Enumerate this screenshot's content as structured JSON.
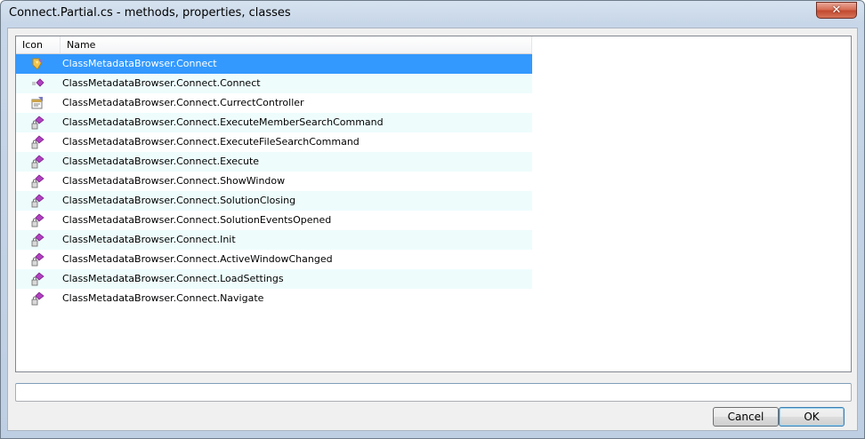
{
  "window": {
    "title": "Connect.Partial.cs - methods, properties, classes",
    "close_glyph": "✕"
  },
  "list": {
    "columns": {
      "icon": "Icon",
      "name": "Name"
    },
    "items": [
      {
        "icon": "class-icon",
        "name": "ClassMetadataBrowser.Connect",
        "selected": true
      },
      {
        "icon": "constructor-icon",
        "name": "ClassMetadataBrowser.Connect.Connect"
      },
      {
        "icon": "property-icon",
        "name": "ClassMetadataBrowser.Connect.CurrectController"
      },
      {
        "icon": "private-method-icon",
        "name": "ClassMetadataBrowser.Connect.ExecuteMemberSearchCommand"
      },
      {
        "icon": "private-method-icon",
        "name": "ClassMetadataBrowser.Connect.ExecuteFileSearchCommand"
      },
      {
        "icon": "private-method-icon",
        "name": "ClassMetadataBrowser.Connect.Execute"
      },
      {
        "icon": "private-method-icon",
        "name": "ClassMetadataBrowser.Connect.ShowWindow"
      },
      {
        "icon": "private-method-icon",
        "name": "ClassMetadataBrowser.Connect.SolutionClosing"
      },
      {
        "icon": "private-method-icon",
        "name": "ClassMetadataBrowser.Connect.SolutionEventsOpened"
      },
      {
        "icon": "private-method-icon",
        "name": "ClassMetadataBrowser.Connect.Init"
      },
      {
        "icon": "private-method-icon",
        "name": "ClassMetadataBrowser.Connect.ActiveWindowChanged"
      },
      {
        "icon": "private-method-icon",
        "name": "ClassMetadataBrowser.Connect.LoadSettings"
      },
      {
        "icon": "private-method-icon",
        "name": "ClassMetadataBrowser.Connect.Navigate"
      }
    ]
  },
  "filter": {
    "value": ""
  },
  "buttons": {
    "cancel": "Cancel",
    "ok": "OK"
  },
  "colors": {
    "selection": "#3399ff",
    "alt_row": "#eefcfc",
    "method_purple": "#b040c0"
  }
}
